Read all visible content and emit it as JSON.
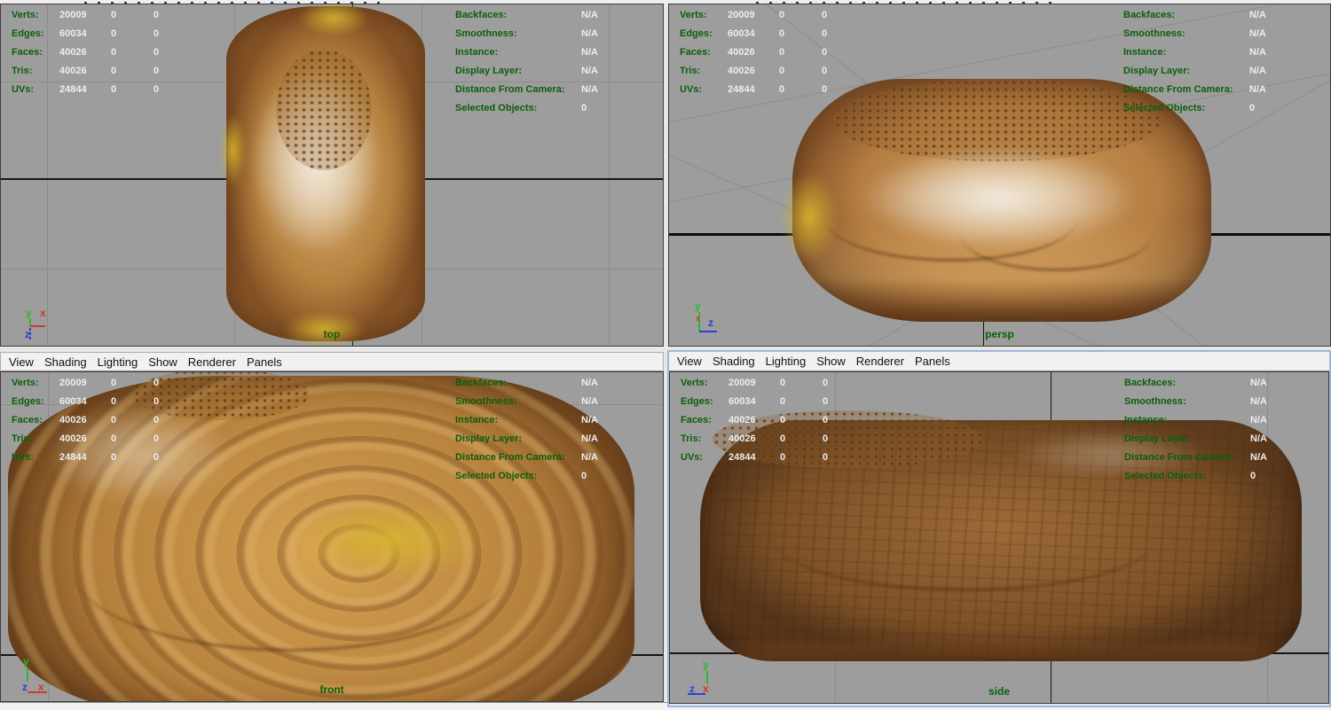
{
  "menu": {
    "items": [
      "View",
      "Shading",
      "Lighting",
      "Show",
      "Renderer",
      "Panels"
    ]
  },
  "hud": {
    "left_rows": [
      {
        "label": "Verts:",
        "v1": "20009",
        "v2": "0",
        "v3": "0"
      },
      {
        "label": "Edges:",
        "v1": "60034",
        "v2": "0",
        "v3": "0"
      },
      {
        "label": "Faces:",
        "v1": "40026",
        "v2": "0",
        "v3": "0"
      },
      {
        "label": "Tris:",
        "v1": "40026",
        "v2": "0",
        "v3": "0"
      },
      {
        "label": "UVs:",
        "v1": "24844",
        "v2": "0",
        "v3": "0"
      }
    ],
    "right_rows": [
      {
        "label": "Backfaces:",
        "value": "N/A"
      },
      {
        "label": "Smoothness:",
        "value": "N/A"
      },
      {
        "label": "Instance:",
        "value": "N/A"
      },
      {
        "label": "Display Layer:",
        "value": "N/A"
      },
      {
        "label": "Distance From Camera:",
        "value": "N/A"
      },
      {
        "label": "Selected Objects:",
        "value": "0"
      }
    ]
  },
  "viewports": {
    "top": {
      "label": "top"
    },
    "persp": {
      "label": "persp"
    },
    "front": {
      "label": "front"
    },
    "side": {
      "label": "side"
    }
  },
  "axes": {
    "x": "x",
    "y": "y",
    "z": "z"
  },
  "colors": {
    "hud_label_green": "#0b5e0b",
    "hud_value_white": "#ededed",
    "viewport_bg": "#9d9d9d",
    "grid_line": "#8c8c8c",
    "axis_line_black": "#151515",
    "active_panel_border": "#9cb8d8",
    "menu_text": "#111111",
    "axis_x_red": "#cf3a28",
    "axis_y_green": "#2db82d",
    "axis_z_blue": "#2a3fd6"
  }
}
